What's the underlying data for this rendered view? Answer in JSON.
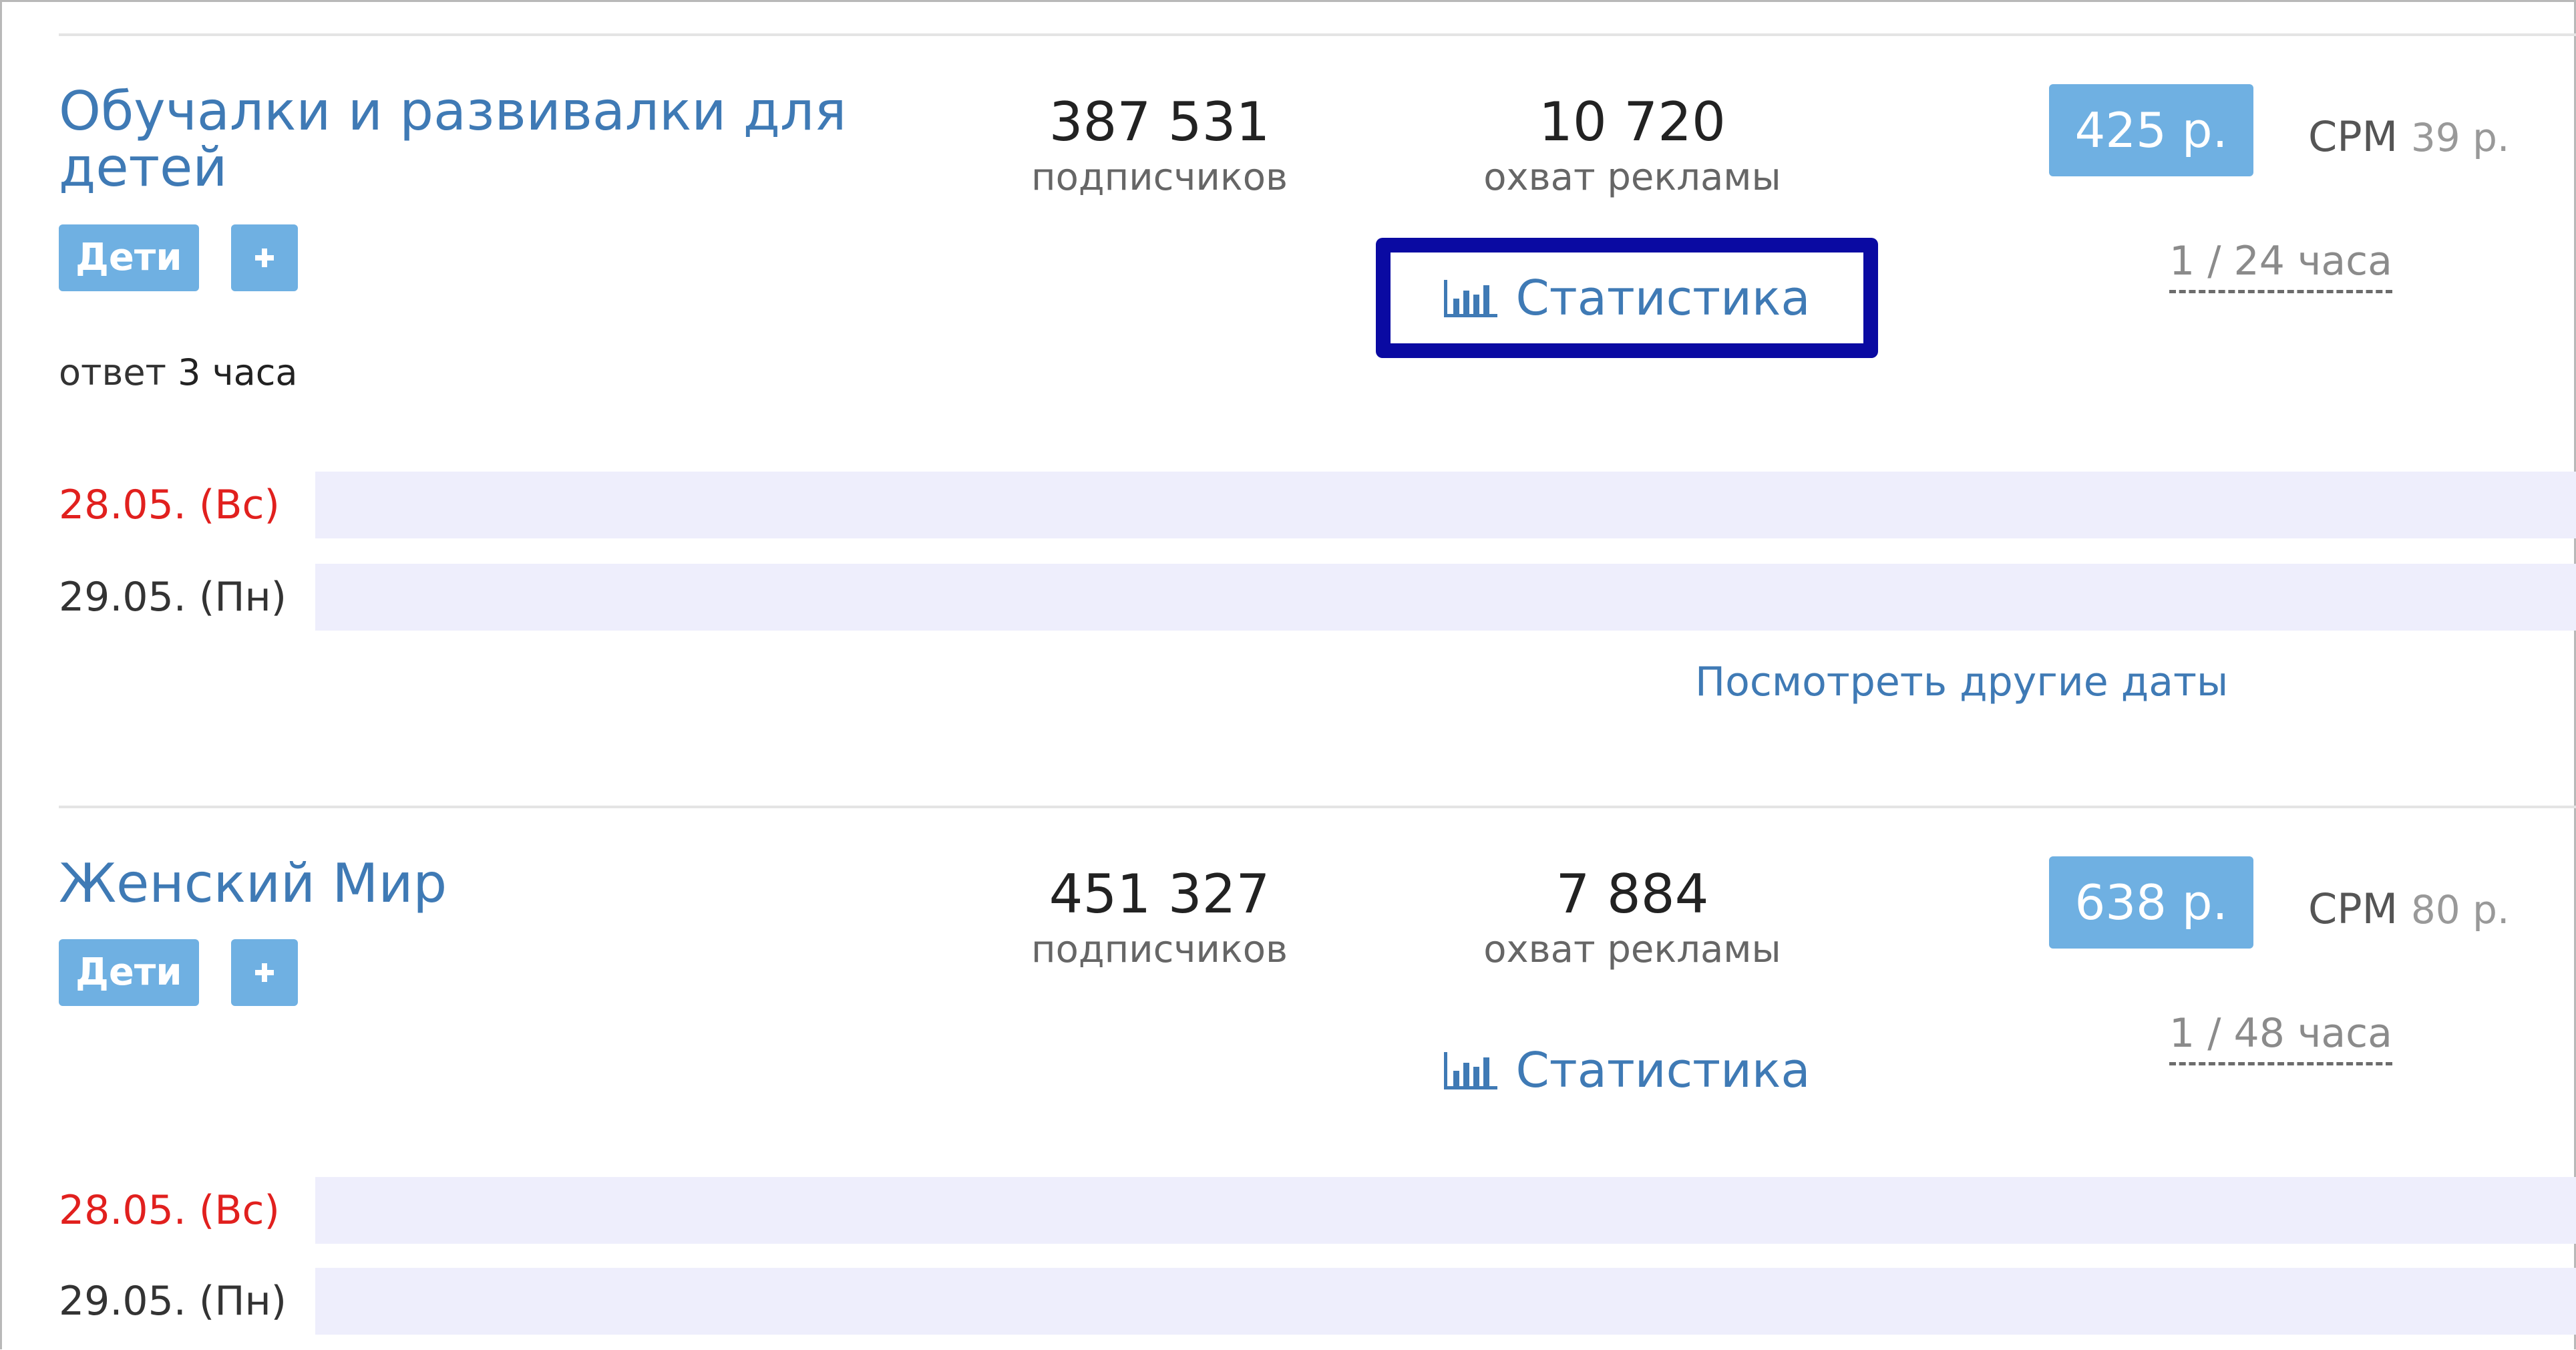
{
  "channels": [
    {
      "title": "Обучалки и развивалки для детей",
      "tag": "Дети",
      "reply_prefix": "ответ",
      "reply_time": "3 часа",
      "subscribers": "387 531",
      "subscribers_label": "подписчиков",
      "reach": "10 720",
      "reach_label": "охват рекламы",
      "stats_link": "Статистика",
      "price": "425 р.",
      "cpm_label": "CPM",
      "cpm_value": "39 р.",
      "frequency": "1 / 24 часа",
      "dates": [
        {
          "label": "28.05. (Вс)",
          "color": "#e1201e"
        },
        {
          "label": "29.05. (Пн)",
          "color": "#333333"
        }
      ],
      "other_dates_link": "Посмотреть другие даты",
      "highlighted": true
    },
    {
      "title": "Женский Мир",
      "tag": "Дети",
      "subscribers": "451 327",
      "subscribers_label": "подписчиков",
      "reach": "7 884",
      "reach_label": "охват рекламы",
      "stats_link": "Статистика",
      "price": "638 р.",
      "cpm_label": "CPM",
      "cpm_value": "80 р.",
      "frequency": "1 / 48 часа",
      "dates": [
        {
          "label": "28.05. (Вс)",
          "color": "#e1201e"
        },
        {
          "label": "29.05. (Пн)",
          "color": "#333333"
        }
      ]
    }
  ],
  "colors": {
    "accent": "#6fb0e2",
    "link": "#3f7ab5",
    "highlight_border": "#0a0aa2",
    "weekend_date": "#e1201e",
    "date_bar": "#eeeefc"
  },
  "icons": {
    "stats": "bar-chart-icon",
    "add": "plus-icon"
  }
}
